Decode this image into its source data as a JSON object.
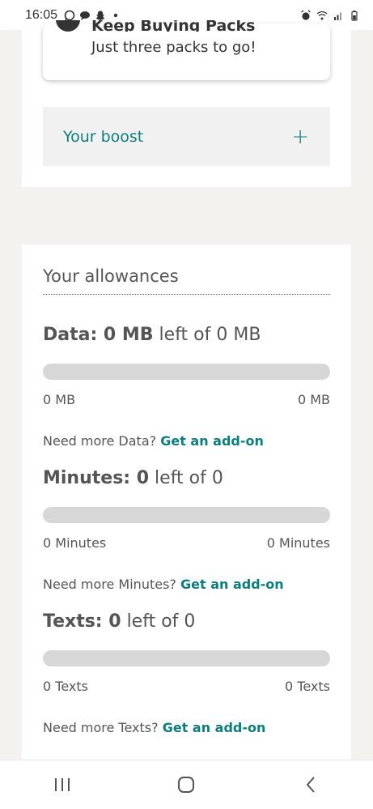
{
  "status_bar": {
    "time": "16:05",
    "left_icons": [
      "whatsapp-icon",
      "chat-icon",
      "snapchat-icon",
      "dot"
    ],
    "right_icons": [
      "alarm-icon",
      "wifi-icon",
      "signal-icon",
      "battery-icon"
    ]
  },
  "pack_card": {
    "heading": "Keep Buying Packs",
    "subtext": "Just three packs to go!"
  },
  "boost": {
    "label": "Your boost",
    "toggle": "+"
  },
  "allowances": {
    "title": "Your allowances",
    "sections": [
      {
        "head_bold": "Data: 0 MB",
        "head_rest": " left of 0 MB",
        "used_fraction": 0,
        "min_label": "0 MB",
        "max_label": "0 MB",
        "more_text": "Need more Data? ",
        "more_link": "Get an add-on"
      },
      {
        "head_bold": "Minutes: 0",
        "head_rest": " left of 0",
        "used_fraction": 0,
        "min_label": "0 Minutes",
        "max_label": "0 Minutes",
        "more_text": "Need more Minutes? ",
        "more_link": "Get an add-on"
      },
      {
        "head_bold": "Texts: 0",
        "head_rest": " left of 0",
        "used_fraction": 0,
        "min_label": "0 Texts",
        "max_label": "0 Texts",
        "more_text": "Need more Texts? ",
        "more_link": "Get an add-on"
      }
    ]
  },
  "colors": {
    "accent": "#0c7d7d",
    "bar_track": "#d7d7d7",
    "page_bg": "#f3f2ef"
  }
}
